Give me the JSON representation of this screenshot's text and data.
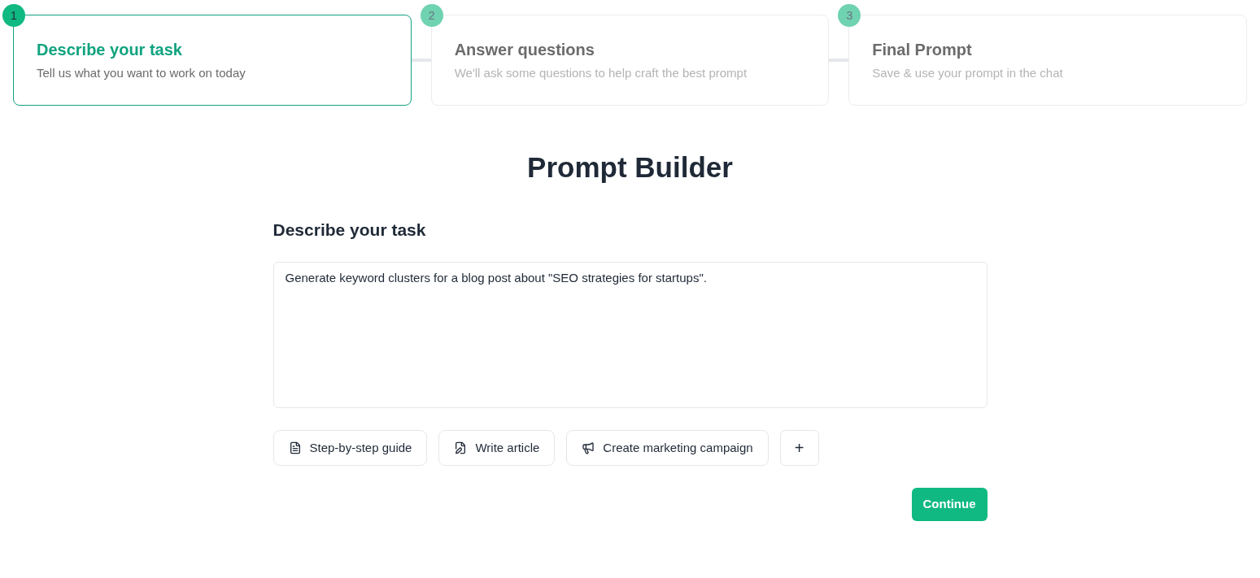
{
  "steps": [
    {
      "number": "1",
      "title": "Describe your task",
      "subtitle": "Tell us what you want to work on today",
      "selected": true
    },
    {
      "number": "2",
      "title": "Answer questions",
      "subtitle": "We'll ask some questions to help craft the best prompt",
      "selected": false
    },
    {
      "number": "3",
      "title": "Final Prompt",
      "subtitle": "Save & use your prompt in the chat",
      "selected": false
    }
  ],
  "page_title": "Prompt Builder",
  "section_title": "Describe your task",
  "task_field": {
    "value": "Generate keyword clusters for a blog post about \"SEO strategies for startups\"."
  },
  "templates": [
    {
      "kind": "guide",
      "label": "Step-by-step guide"
    },
    {
      "kind": "article",
      "label": "Write article"
    },
    {
      "kind": "campaign",
      "label": "Create marketing campaign"
    }
  ],
  "add_button": "+",
  "continue_button": "Continue"
}
